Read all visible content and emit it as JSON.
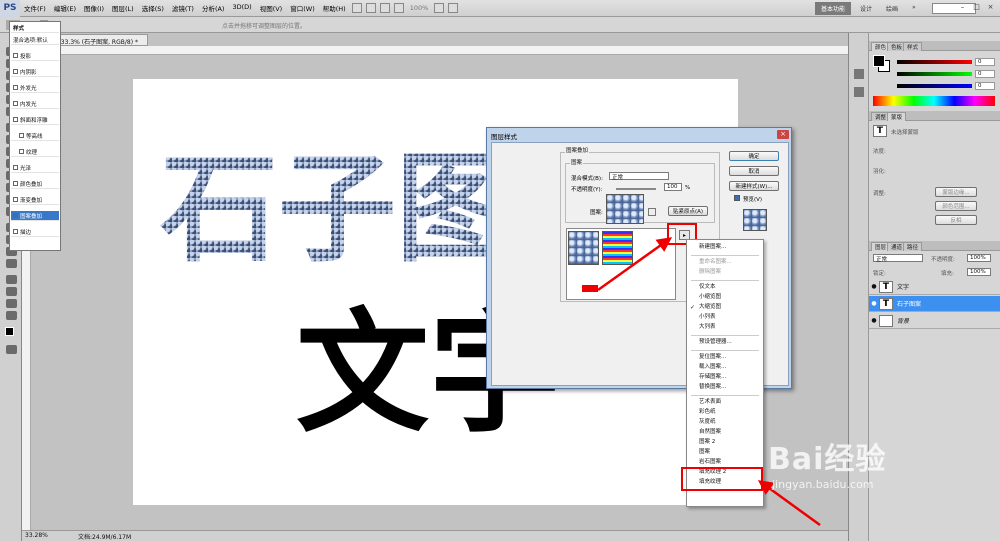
{
  "app": {
    "logo": "PS"
  },
  "menubar": {
    "items": [
      "文件(F)",
      "编辑(E)",
      "图像(I)",
      "图层(L)",
      "选择(S)",
      "滤镜(T)",
      "分析(A)",
      "3D(D)",
      "视图(V)",
      "窗口(W)",
      "帮助(H)"
    ],
    "zoom": "100%",
    "workspace": "基本功能",
    "design": "设计",
    "painting": "绘画"
  },
  "options": {
    "hint": "点击并拖移可调整图层的位置。"
  },
  "document": {
    "tab_title": "未标题-1 @ 33.3% (石子图案, RGB/8) *",
    "stone_text": "石子图",
    "black_text": "文字",
    "zoom": "33.28%",
    "doc_size": "文档:24.9M/6.17M"
  },
  "panels": {
    "color_tabs": [
      "颜色",
      "色板",
      "样式"
    ],
    "color_values": [
      "0",
      "0",
      "0"
    ],
    "adjust_tabs": [
      "调整",
      "蒙版"
    ],
    "mask_text": "未选择蒙版",
    "density_label": "浓度:",
    "feather_label": "羽化:",
    "refine_label": "调整:",
    "mask_edge": "蒙版边缘...",
    "color_range": "颜色范围...",
    "invert": "反相",
    "layer_tabs": [
      "图层",
      "通道",
      "路径"
    ],
    "blend_mode": "正常",
    "opacity_label": "不透明度:",
    "opacity": "100%",
    "lock_label": "锁定:",
    "fill_label": "填充:",
    "fill": "100%",
    "layers": [
      {
        "name": "文字",
        "thumb": "T"
      },
      {
        "name": "石子图案",
        "thumb": "T"
      },
      {
        "name": "背景",
        "thumb": ""
      }
    ]
  },
  "dialog": {
    "title": "图层样式",
    "styles_header": "样式",
    "styles": [
      {
        "label": "混合选项:默认",
        "checked": false
      },
      {
        "label": "投影",
        "checked": false
      },
      {
        "label": "内阴影",
        "checked": false
      },
      {
        "label": "外发光",
        "checked": false
      },
      {
        "label": "内发光",
        "checked": false
      },
      {
        "label": "斜面和浮雕",
        "checked": false
      },
      {
        "label": "等高线",
        "checked": false
      },
      {
        "label": "纹理",
        "checked": false
      },
      {
        "label": "光泽",
        "checked": false
      },
      {
        "label": "颜色叠加",
        "checked": false
      },
      {
        "label": "渐变叠加",
        "checked": false
      },
      {
        "label": "图案叠加",
        "checked": true
      },
      {
        "label": "描边",
        "checked": false
      }
    ],
    "section_title": "图案叠加",
    "pattern_group": "图案",
    "blend_label": "混合模式(B):",
    "blend_value": "正常",
    "opacity_label": "不透明度(Y):",
    "opacity_value": "100",
    "opacity_unit": "%",
    "pattern_label": "图案:",
    "snap_button": "贴紧原点(A)",
    "ok": "确定",
    "cancel": "取消",
    "new_style": "新建样式(W)...",
    "preview": "预览(V)"
  },
  "context_menu": {
    "items": [
      {
        "label": "新建图案...",
        "enabled": true
      },
      {
        "sep": true
      },
      {
        "label": "重命名图案...",
        "enabled": false
      },
      {
        "label": "删除图案",
        "enabled": false
      },
      {
        "sep": true
      },
      {
        "label": "仅文本",
        "enabled": true
      },
      {
        "label": "小缩览图",
        "enabled": true
      },
      {
        "label": "大缩览图",
        "enabled": true,
        "checked": true
      },
      {
        "label": "小列表",
        "enabled": true
      },
      {
        "label": "大列表",
        "enabled": true
      },
      {
        "sep": true
      },
      {
        "label": "预设管理器...",
        "enabled": true
      },
      {
        "sep": true
      },
      {
        "label": "复位图案...",
        "enabled": true
      },
      {
        "label": "载入图案...",
        "enabled": true
      },
      {
        "label": "存储图案...",
        "enabled": true
      },
      {
        "label": "替换图案...",
        "enabled": true
      },
      {
        "sep": true
      },
      {
        "label": "艺术表面",
        "enabled": true
      },
      {
        "label": "彩色纸",
        "enabled": true
      },
      {
        "label": "灰度纸",
        "enabled": true
      },
      {
        "label": "自然图案",
        "enabled": true
      },
      {
        "label": "图案 2",
        "enabled": true
      },
      {
        "label": "图案",
        "enabled": true
      },
      {
        "label": "岩石图案",
        "enabled": true
      },
      {
        "label": "填充纹理 2",
        "enabled": true
      },
      {
        "label": "填充纹理",
        "enabled": true
      }
    ]
  },
  "watermark": {
    "logo": "Bai经验",
    "url": "jingyan.baidu.com"
  },
  "colors": {
    "highlight_red": "#e00000",
    "selected_blue": "#3d8ff0"
  }
}
